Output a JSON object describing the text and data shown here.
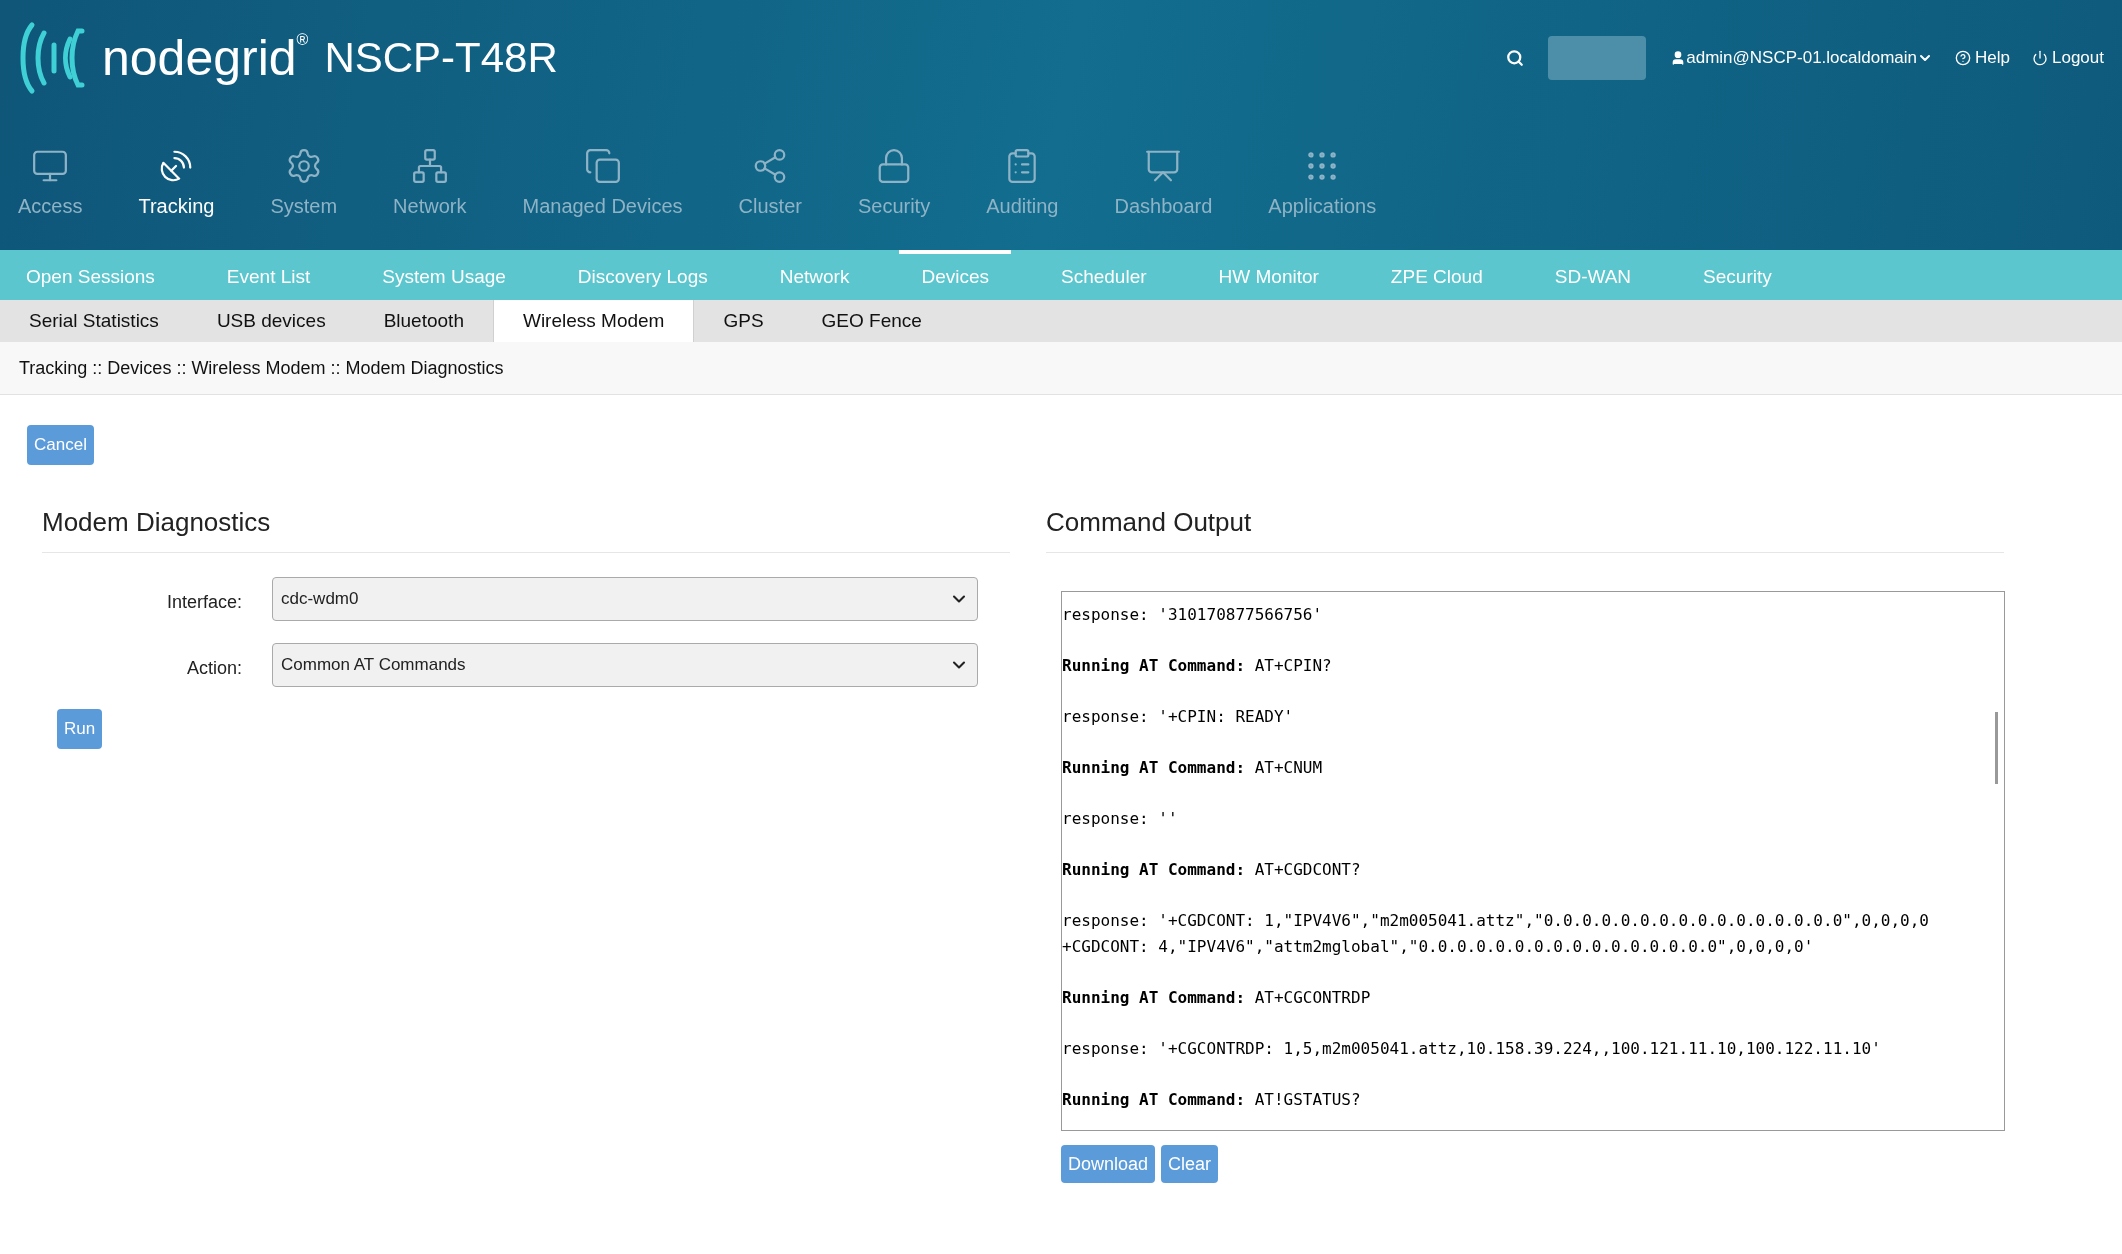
{
  "brand": {
    "name": "nodegrid",
    "registered": "®",
    "model": "NSCP-T48R"
  },
  "header": {
    "user": "admin@NSCP-01.localdomain",
    "help": "Help",
    "logout": "Logout"
  },
  "main_nav": [
    {
      "label": "Access",
      "selected": false
    },
    {
      "label": "Tracking",
      "selected": true
    },
    {
      "label": "System",
      "selected": false
    },
    {
      "label": "Network",
      "selected": false
    },
    {
      "label": "Managed Devices",
      "selected": false
    },
    {
      "label": "Cluster",
      "selected": false
    },
    {
      "label": "Security",
      "selected": false
    },
    {
      "label": "Auditing",
      "selected": false
    },
    {
      "label": "Dashboard",
      "selected": false
    },
    {
      "label": "Applications",
      "selected": false
    }
  ],
  "sub_nav": [
    {
      "label": "Open Sessions",
      "selected": false
    },
    {
      "label": "Event List",
      "selected": false
    },
    {
      "label": "System Usage",
      "selected": false
    },
    {
      "label": "Discovery Logs",
      "selected": false
    },
    {
      "label": "Network",
      "selected": false
    },
    {
      "label": "Devices",
      "selected": true
    },
    {
      "label": "Scheduler",
      "selected": false
    },
    {
      "label": "HW Monitor",
      "selected": false
    },
    {
      "label": "ZPE Cloud",
      "selected": false
    },
    {
      "label": "SD-WAN",
      "selected": false
    },
    {
      "label": "Security",
      "selected": false
    }
  ],
  "tabs": [
    {
      "label": "Serial Statistics",
      "selected": false
    },
    {
      "label": "USB devices",
      "selected": false
    },
    {
      "label": "Bluetooth",
      "selected": false
    },
    {
      "label": "Wireless Modem",
      "selected": true
    },
    {
      "label": "GPS",
      "selected": false
    },
    {
      "label": "GEO Fence",
      "selected": false
    }
  ],
  "breadcrumb": "Tracking :: Devices :: Wireless Modem :: Modem Diagnostics",
  "cancel_button": "Cancel",
  "diagnostics": {
    "title": "Modem Diagnostics",
    "fields": [
      {
        "label": "Interface:",
        "value": "cdc-wdm0"
      },
      {
        "label": "Action:",
        "value": "Common AT Commands"
      }
    ],
    "run_button": "Run"
  },
  "output": {
    "title": "Command Output",
    "lines": [
      {
        "kind": "response",
        "text": "response: '310170877566756'"
      },
      {
        "kind": "command",
        "label": "Running AT Command:",
        "text": "AT+CPIN?"
      },
      {
        "kind": "response",
        "text": "response: '+CPIN: READY'"
      },
      {
        "kind": "command",
        "label": "Running AT Command:",
        "text": "AT+CNUM"
      },
      {
        "kind": "response",
        "text": "response: ''"
      },
      {
        "kind": "command",
        "label": "Running AT Command:",
        "text": "AT+CGDCONT?"
      },
      {
        "kind": "response",
        "text": "response: '+CGDCONT: 1,\"IPV4V6\",\"m2m005041.attz\",\"0.0.0.0.0.0.0.0.0.0.0.0.0.0.0.0\",0,0,0,0\n+CGDCONT: 4,\"IPV4V6\",\"attm2mglobal\",\"0.0.0.0.0.0.0.0.0.0.0.0.0.0.0.0\",0,0,0,0'"
      },
      {
        "kind": "command",
        "label": "Running AT Command:",
        "text": "AT+CGCONTRDP"
      },
      {
        "kind": "response",
        "text": "response: '+CGCONTRDP: 1,5,m2m005041.attz,10.158.39.224,,100.121.11.10,100.122.11.10'"
      },
      {
        "kind": "command",
        "label": "Running AT Command:",
        "text": "AT!GSTATUS?"
      }
    ],
    "buttons": [
      "Download",
      "Clear"
    ]
  }
}
